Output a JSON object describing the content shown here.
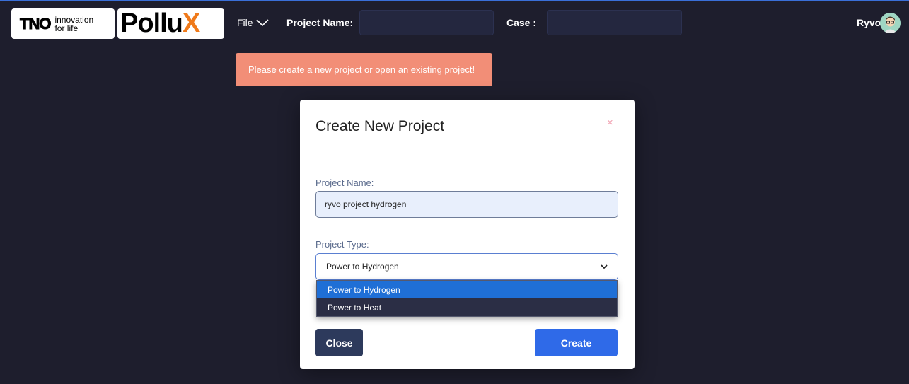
{
  "header": {
    "tno_logo": {
      "word": "TNO",
      "tagline_line1": "innovation",
      "tagline_line2": "for life"
    },
    "pollux_logo": {
      "word": "Pollu",
      "accent": "X"
    },
    "file_menu_label": "File",
    "project_name_label": "Project Name:",
    "project_name_value": "",
    "case_label": "Case :",
    "case_value": "",
    "user_name": "Ryvo"
  },
  "alert": {
    "message": "Please create a new project or open an existing project!"
  },
  "modal": {
    "title": "Create New Project",
    "close_icon": "×",
    "project_name_label": "Project Name:",
    "project_name_value": "ryvo project hydrogen",
    "project_type_label": "Project Type:",
    "project_type_selected": "Power to Hydrogen",
    "project_type_options": [
      "Power to Hydrogen",
      "Power to Heat"
    ],
    "close_button": "Close",
    "create_button": "Create"
  },
  "colors": {
    "background": "#1e1e2d",
    "alert": "#f28e77",
    "accent_blue": "#2f6ae8",
    "pollux_orange": "#f07a1a"
  },
  "icons": {
    "file_menu": "chevron-down-icon",
    "modal_close": "close-icon",
    "select": "chevron-down-icon",
    "user": "avatar"
  }
}
